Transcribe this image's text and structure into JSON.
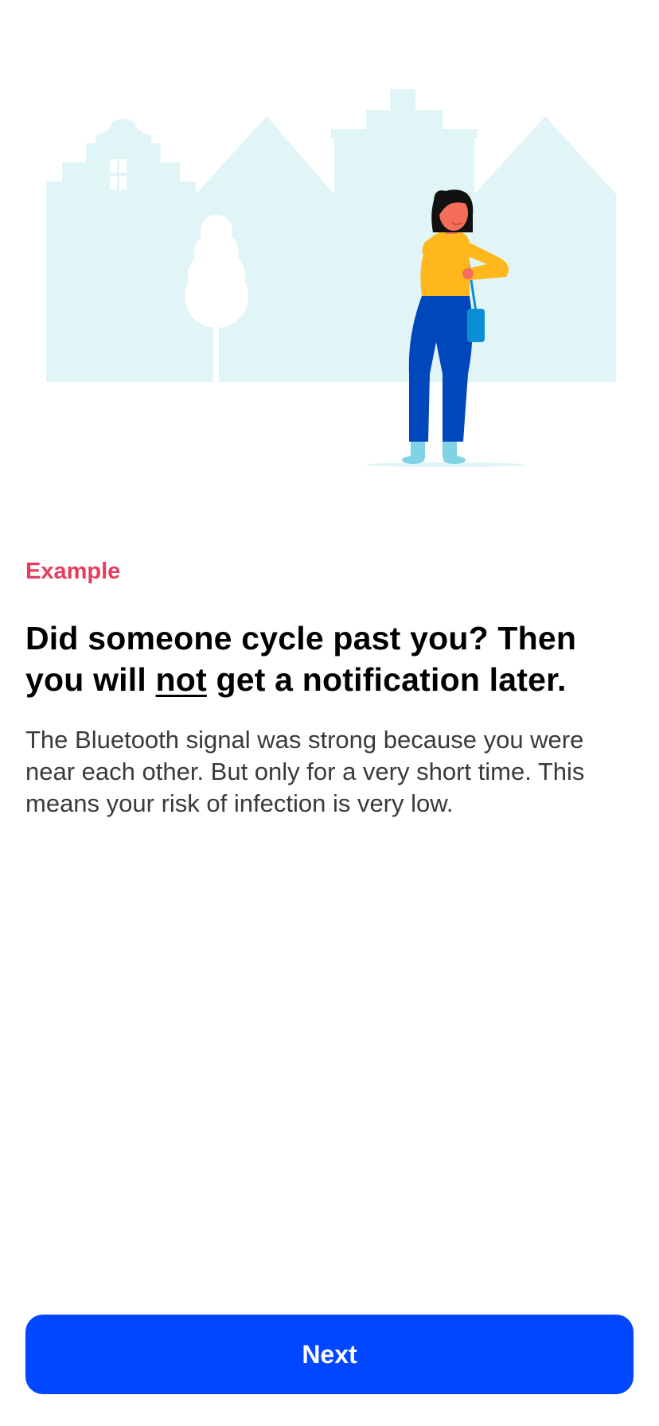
{
  "header": {
    "eyebrow": "Example"
  },
  "main": {
    "title_part1": "Did someone cycle past you? Then you will ",
    "title_emphasis": "not",
    "title_part2": " get a notification later.",
    "body": "The Bluetooth signal was strong because you were near each other. But only for a very short time. This means your risk of infection is very low."
  },
  "footer": {
    "next_label": "Next"
  },
  "colors": {
    "accent": "#e63d5e",
    "button": "#0047ff",
    "buildings": "#e1f5f7",
    "shirt": "#ffb81c",
    "trousers": "#0047bb"
  },
  "illustration": {
    "icon": "woman-checking-watch-street-illustration"
  }
}
